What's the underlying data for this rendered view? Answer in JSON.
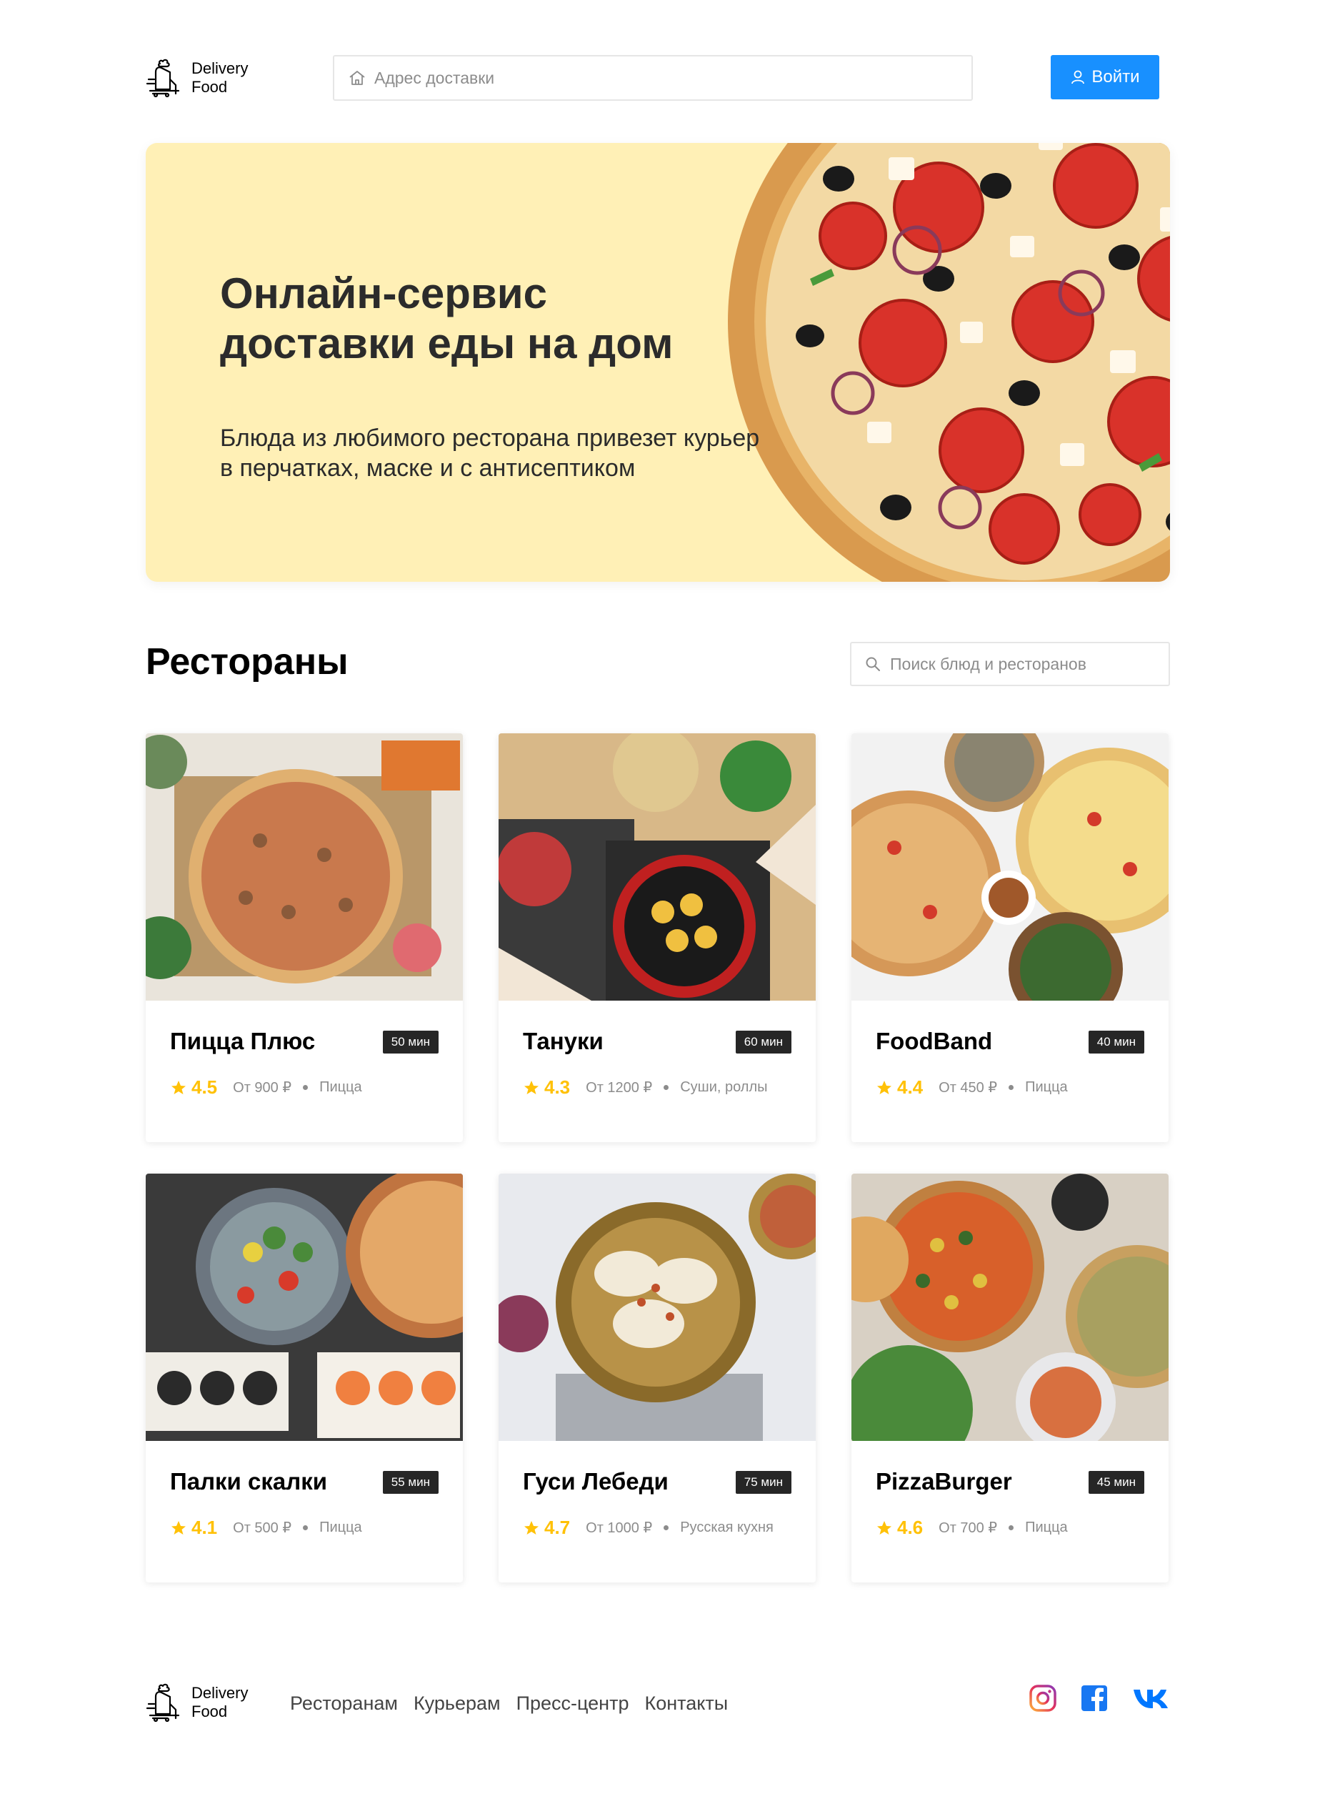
{
  "header": {
    "logo_line1": "Delivery",
    "logo_line2": "Food",
    "address_placeholder": "Адрес доставки",
    "login_label": "Войти",
    "accent_color": "#1890ff"
  },
  "promo": {
    "title_line1": "Онлайн-сервис",
    "title_line2": "доставки еды на дом",
    "text_line1": "Блюда из любимого ресторана привезет курьер",
    "text_line2": "в перчатках, маске и с антисептиком",
    "background_color": "#fff0b6"
  },
  "restaurants": {
    "title": "Рестораны",
    "search_placeholder": "Поиск блюд и ресторанов",
    "cards": [
      {
        "name": "Пицца Плюс",
        "time": "50 мин",
        "rating": "4.5",
        "price": "От 900 ₽",
        "category": "Пицца"
      },
      {
        "name": "Тануки",
        "time": "60 мин",
        "rating": "4.3",
        "price": "От 1200 ₽",
        "category": "Суши, роллы"
      },
      {
        "name": "FoodBand",
        "time": "40 мин",
        "rating": "4.4",
        "price": "От 450 ₽",
        "category": "Пицца"
      },
      {
        "name": "Палки скалки",
        "time": "55 мин",
        "rating": "4.1",
        "price": "От 500 ₽",
        "category": "Пицца"
      },
      {
        "name": "Гуси Лебеди",
        "time": "75 мин",
        "rating": "4.7",
        "price": "От 1000 ₽",
        "category": "Русская кухня"
      },
      {
        "name": "PizzaBurger",
        "time": "45 мин",
        "rating": "4.6",
        "price": "От 700 ₽",
        "category": "Пицца"
      }
    ]
  },
  "footer": {
    "logo_line1": "Delivery",
    "logo_line2": "Food",
    "nav": [
      "Ресторанам",
      "Курьерам",
      "Пресс-центр",
      "Контакты"
    ],
    "socials": [
      "instagram-icon",
      "facebook-icon",
      "vk-icon"
    ]
  }
}
